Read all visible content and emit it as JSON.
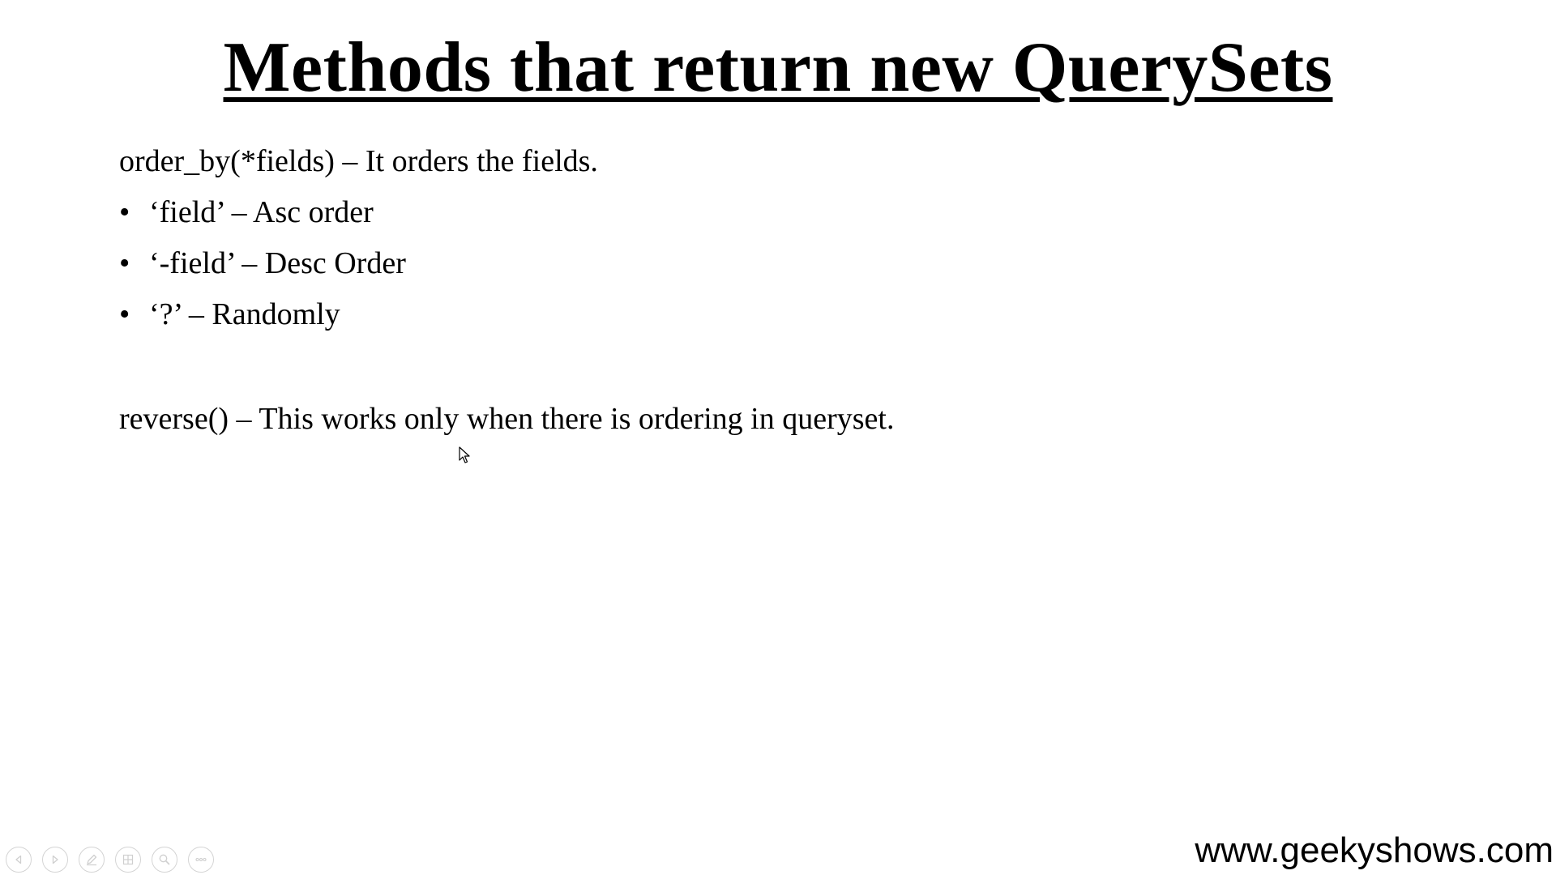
{
  "slide": {
    "title": "Methods that return new QuerySets",
    "order_by_line": "order_by(*fields) – It orders the fields.",
    "bullets": [
      {
        "marker": "•",
        "text": "‘field’ – Asc order"
      },
      {
        "marker": "•",
        "text": "‘-field’ – Desc Order"
      },
      {
        "marker": "•",
        "text": "‘?’ – Randomly"
      }
    ],
    "reverse_line": "reverse() – This works only when there is ordering in queryset.",
    "footer_url": "www.geekyshows.com"
  },
  "controls": [
    {
      "icon": "previous-icon"
    },
    {
      "icon": "next-icon"
    },
    {
      "icon": "pen-icon"
    },
    {
      "icon": "slides-icon"
    },
    {
      "icon": "zoom-icon"
    },
    {
      "icon": "more-icon"
    }
  ],
  "colors": {
    "background": "#ffffff",
    "text": "#000000",
    "control_stroke": "#d4d4d4"
  }
}
